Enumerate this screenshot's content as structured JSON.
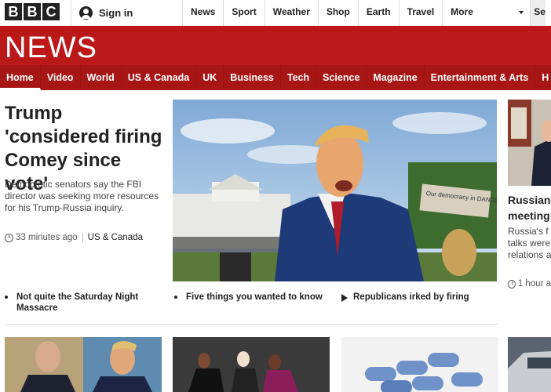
{
  "logo": {
    "letters": [
      "B",
      "B",
      "C"
    ]
  },
  "account": {
    "signin_label": "Sign in",
    "icon": "user-icon"
  },
  "top_nav": {
    "items": [
      "News",
      "Sport",
      "Weather",
      "Shop",
      "Earth",
      "Travel"
    ],
    "more_label": "More",
    "search_partial": "Se"
  },
  "section_title": "NEWS",
  "sub_nav": {
    "items": [
      "Home",
      "Video",
      "World",
      "US & Canada",
      "UK",
      "Business",
      "Tech",
      "Science",
      "Magazine",
      "Entertainment & Arts",
      "H"
    ],
    "active": "Home"
  },
  "lead_story": {
    "headline": "Trump 'considered firing Comey since vote'",
    "summary": "Democratic senators say the FBI director was seeking more resources for his Trump-Russia inquiry.",
    "time": "33 minutes ago",
    "tag": "US & Canada",
    "sign_text": "Our democracy in DANGER"
  },
  "related": [
    {
      "text": "Not quite the Saturday Night Massacre",
      "icon": "bullet"
    },
    {
      "text": "Five things you wanted to know",
      "icon": "bullet"
    },
    {
      "text": "Republicans irked by firing",
      "icon": "play-icon"
    }
  ],
  "side_story": {
    "title_lines": [
      "Russian",
      "meeting"
    ],
    "summary_lines": [
      "Russia's f",
      "talks were",
      "relations a"
    ],
    "time": "1 hour a"
  }
}
